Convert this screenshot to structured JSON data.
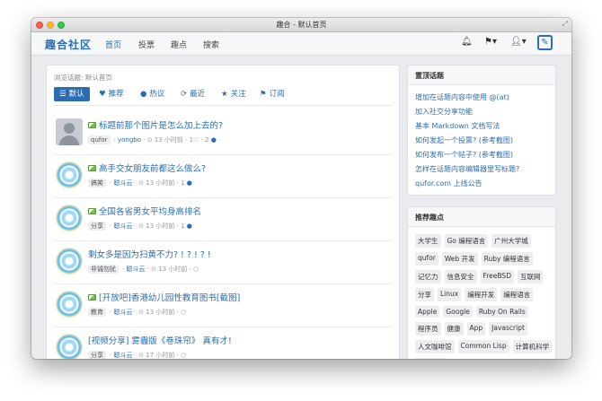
{
  "window": {
    "title": "趣合 - 默认首页"
  },
  "navbar": {
    "brand": "趣合社区",
    "items": [
      "首页",
      "投票",
      "趣点",
      "搜索"
    ],
    "active_index": 0,
    "icons": [
      "bell-icon",
      "bookmark-icon",
      "user-icon",
      "compose-icon"
    ]
  },
  "main": {
    "breadcrumb": "浏览话题: 默认首页",
    "tabs": [
      {
        "label": "默认",
        "icon": "list-icon"
      },
      {
        "label": "推荐",
        "icon": "heart-icon"
      },
      {
        "label": "热议",
        "icon": "comments-icon"
      },
      {
        "label": "最近",
        "icon": "refresh-icon"
      },
      {
        "label": "关注",
        "icon": "star-icon"
      },
      {
        "label": "订阅",
        "icon": "bookmark-icon"
      }
    ],
    "topics": [
      {
        "title": "标题前那个图片是怎么加上去的?",
        "has_image": true,
        "node": "qufor",
        "author": "yongbo",
        "time": "13 小时前",
        "likes": "1",
        "comments": "2"
      },
      {
        "title": "高手交女朋友前都这么做么?",
        "has_image": true,
        "node": "搞笑",
        "author": "聪斗云",
        "time": "13 小时前",
        "likes": "",
        "comments": "1"
      },
      {
        "title": "全国各省男女平均身高排名",
        "has_image": true,
        "node": "分享",
        "author": "聪斗云",
        "time": "13 小时前",
        "likes": "",
        "comments": "1"
      },
      {
        "title": "剩女多是因为扫黄不力? ! ? ! ? !",
        "has_image": false,
        "node": "非诚勿扰",
        "author": "聪斗云",
        "time": "13 小时前",
        "likes": "",
        "comments": ""
      },
      {
        "title": "[开放吧]香港幼儿园性教育图书[截图]",
        "has_image": true,
        "node": "教育",
        "author": "聪斗云",
        "time": "13 小时前",
        "likes": "",
        "comments": ""
      },
      {
        "title": "[视频分享] 雾霾版《卷珠帘》 真有才!",
        "has_image": false,
        "node": "分享",
        "author": "聪斗云",
        "time": "17 小时前",
        "likes": "",
        "comments": ""
      }
    ]
  },
  "sidebar": {
    "pinned_title": "置顶话题",
    "pinned": [
      "增加在话题内容中使用 @(at)",
      "加入社交分享功能",
      "基本 Markdown 文档写法",
      "如何发起一个投票? (参考截图)",
      "如何发布一个帖子? (参考截图)",
      "怎样在话题内容编辑器里写标题?",
      "qufor.com 上线公告"
    ],
    "nodes_title": "推荐趣点",
    "nodes": [
      "大学生",
      "Go 编程语言",
      "广州大学城",
      "qufor",
      "Web 开发",
      "Ruby 编程语言",
      "记忆力",
      "信息安全",
      "FreeBSD",
      "互联网",
      "分享",
      "Linux",
      "编程开发",
      "编程语言",
      "Apple",
      "Google",
      "Ruby On Rails",
      "程序员",
      "健康",
      "App",
      "Javascript",
      "人文咖啡馆",
      "Common Lisp",
      "计算机科学",
      "Mac OS"
    ]
  },
  "colors": {
    "accent": "#2a6db3",
    "background": "#e9ebee"
  }
}
